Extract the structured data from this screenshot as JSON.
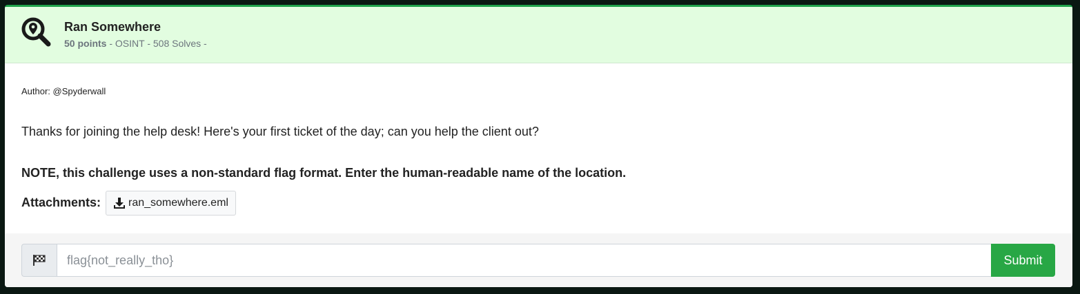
{
  "challenge": {
    "title": "Ran Somewhere",
    "points": "50 points",
    "meta_rest": " - OSINT - 508 Solves -",
    "icon": "map-search-icon"
  },
  "body": {
    "author": "Author: @Spyderwall",
    "description": "Thanks for joining the help desk! Here's your first ticket of the day; can you help the client out?",
    "note": "NOTE, this challenge uses a non-standard flag format. Enter the human-readable name of the location.",
    "attachments_label": "Attachments:",
    "attachment_file": "ran_somewhere.eml"
  },
  "flag_form": {
    "placeholder": "flag{not_really_tho}",
    "submit_label": "Submit",
    "prefix_icon": "checkered-flag-icon"
  },
  "colors": {
    "header_bg": "#e2fde0",
    "accent": "#28a745",
    "page_bg": "#0a1812"
  }
}
